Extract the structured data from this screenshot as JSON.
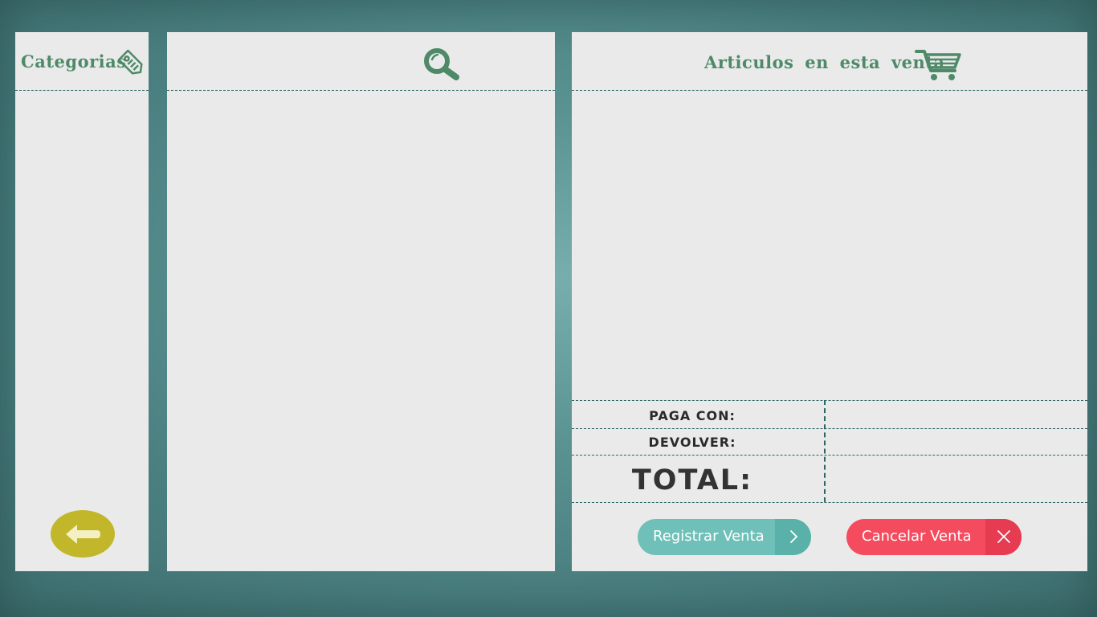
{
  "categories_panel": {
    "title": "Categorias",
    "tag_icon": "price-tag-icon",
    "back_icon": "arrow-left-icon"
  },
  "products_panel": {
    "search_icon": "search-icon"
  },
  "sale_panel": {
    "title": "Articulos en esta venta",
    "cart_icon": "shopping-cart-icon",
    "summary": {
      "paga_con_label": "PAGA CON:",
      "devolver_label": "DEVOLVER:",
      "total_label": "TOTAL:",
      "paga_con_value": "",
      "devolver_value": "",
      "total_value": ""
    },
    "register_button": {
      "label": "Registrar Venta",
      "icon": "chevron-right-icon",
      "color": "#6fc0b8"
    },
    "cancel_button": {
      "label": "Cancelar Venta",
      "icon": "close-icon",
      "color": "#f44c5e"
    }
  },
  "colors": {
    "accent_green": "#4e8a68",
    "panel_bg": "#eaeaea",
    "back_button": "#c2b62a"
  }
}
